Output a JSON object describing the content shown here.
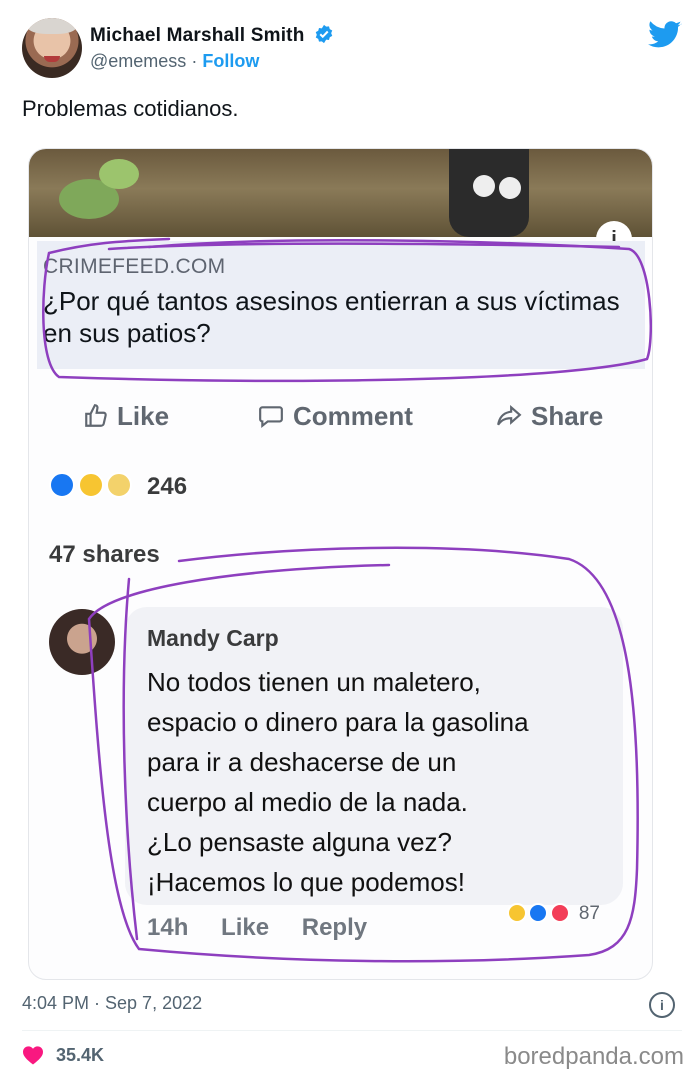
{
  "tweet": {
    "author_name": "Michael Marshall Smith",
    "handle": "@ememess",
    "separator": "·",
    "follow_label": "Follow",
    "text": "Problemas cotidianos.",
    "timestamp": "4:04 PM · Sep 7, 2022",
    "likes": "35.4K",
    "info_glyph": "i"
  },
  "card": {
    "domain": "CRIMEFEED.COM",
    "headline": "¿Por qué tantos asesinos entierran a sus víctimas en sus patios?",
    "info_glyph": "i",
    "actions": {
      "like": "Like",
      "comment": "Comment",
      "share": "Share"
    },
    "reaction_count": "246",
    "shares": "47 shares",
    "comment": {
      "author": "Mandy Carp",
      "lines": [
        "No todos tienen un maletero,",
        "espacio o dinero para la gasolina",
        "para ir a deshacerse de un",
        "cuerpo al medio de la nada.",
        "¿Lo pensaste alguna vez?",
        "¡Hacemos lo que podemos!"
      ],
      "time": "14h",
      "like": "Like",
      "reply": "Reply",
      "reaction_count": "87"
    }
  },
  "watermark": "boredpanda.com",
  "colors": {
    "twitter_blue": "#1d9bf0",
    "like_pink": "#f91880",
    "scribble_purple": "#8e3fbf",
    "fb_gray": "#606770"
  },
  "icons": [
    "verified-badge-icon",
    "twitter-bird-icon",
    "info-icon",
    "thumbs-up-icon",
    "comment-icon",
    "share-icon",
    "heart-icon"
  ]
}
